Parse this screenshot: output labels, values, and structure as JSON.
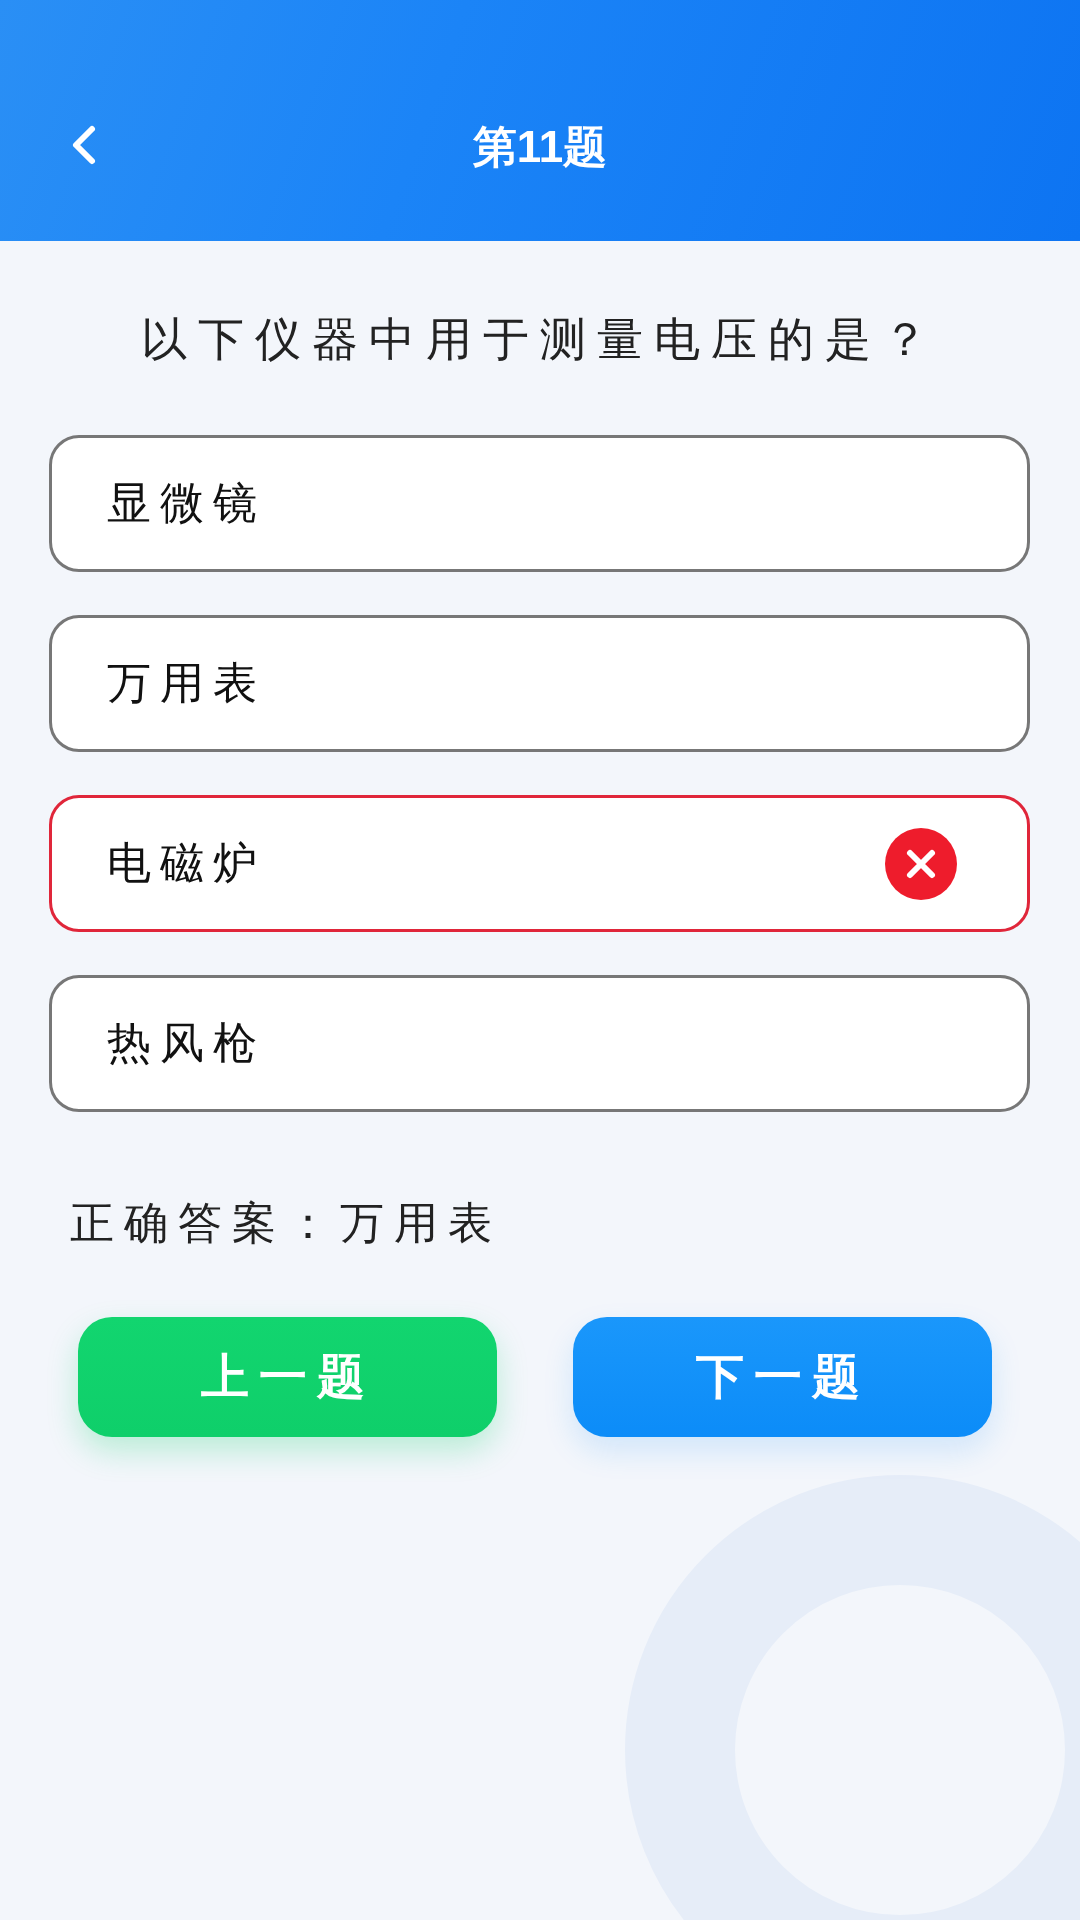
{
  "header": {
    "title": "第11题"
  },
  "question": "以下仪器中用于测量电压的是？",
  "options": [
    {
      "label": "显微镜",
      "wrong": false
    },
    {
      "label": "万用表",
      "wrong": false
    },
    {
      "label": "电磁炉",
      "wrong": true
    },
    {
      "label": "热风枪",
      "wrong": false
    }
  ],
  "answer": "正确答案：万用表",
  "buttons": [
    {
      "label": "上一题",
      "kind": "prev"
    },
    {
      "label": "下一题",
      "kind": "next"
    }
  ]
}
